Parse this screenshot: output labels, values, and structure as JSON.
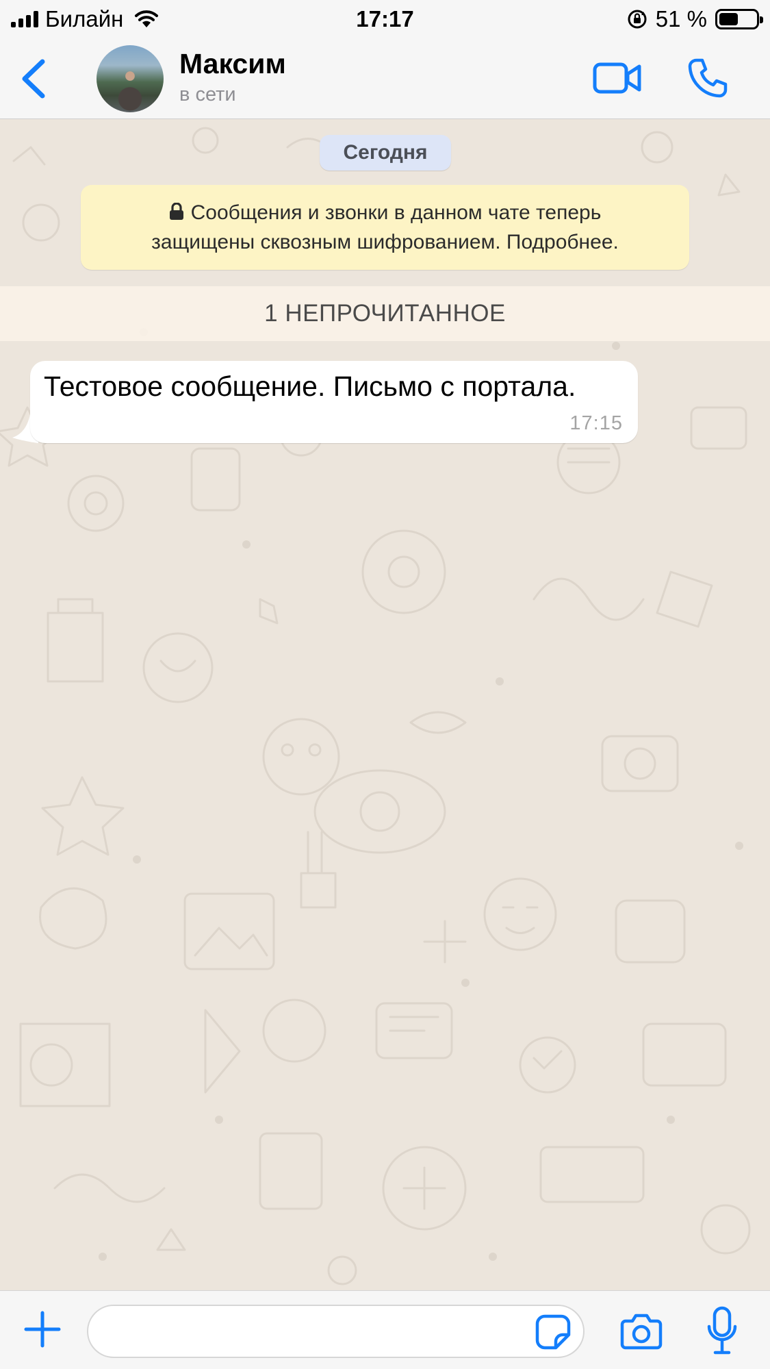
{
  "status_bar": {
    "carrier": "Билайн",
    "time": "17:17",
    "battery_percent": "51 %",
    "battery_level": 0.51
  },
  "header": {
    "contact_name": "Максим",
    "contact_status": "в сети",
    "icons": {
      "back": "chevron-left-icon",
      "avatar": "avatar",
      "video": "video-camera-icon",
      "call": "phone-icon"
    }
  },
  "chat": {
    "date_label": "Сегодня",
    "encryption_notice_line1": "Сообщения и звонки в данном чате теперь",
    "encryption_notice_line2": "защищены сквозным шифрованием. Подробнее.",
    "unread_label": "1 НЕПРОЧИТАННОЕ",
    "messages": [
      {
        "text": "Тестовое сообщение. Письмо с портала.",
        "time": "17:15",
        "direction": "incoming"
      }
    ]
  },
  "input_bar": {
    "placeholder": "",
    "icons": {
      "attach": "plus-icon",
      "sticker": "sticker-icon",
      "camera": "camera-icon",
      "mic": "microphone-icon"
    }
  },
  "colors": {
    "accent": "#147efb",
    "chat_background": "#ece5dc",
    "date_pill": "#dde5f7",
    "encryption_notice": "#fdf4c5",
    "bubble_incoming": "#ffffff"
  }
}
